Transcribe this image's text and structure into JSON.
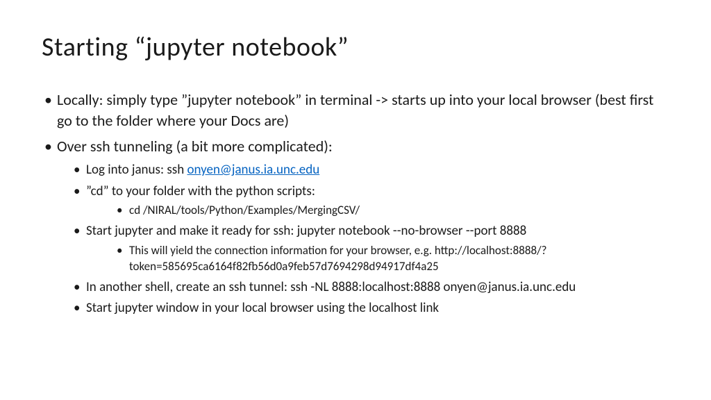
{
  "title": "Starting “jupyter notebook”",
  "bullets": {
    "b1": "Locally: simply type ”jupyter notebook” in terminal -> starts up into your local browser (best first go to the folder where your Docs are)",
    "b2": "Over ssh tunneling (a bit more complicated):",
    "b2_1_pre": "Log into janus: ssh ",
    "b2_1_link": "onyen@janus.ia.unc.edu",
    "b2_2": "”cd” to your folder with the python scripts:",
    "b2_2_1": "cd /NIRAL/tools/Python/Examples/MergingCSV/",
    "b2_3": "Start jupyter and make it ready for ssh: jupyter notebook --no-browser --port 8888",
    "b2_3_1": "This will yield the connection information for your browser, e.g. http://localhost:8888/?token=585695ca6164f82fb56d0a9feb57d7694298d94917df4a25",
    "b2_4": "In another shell, create an ssh tunnel: ssh -NL 8888:localhost:8888 onyen@janus.ia.unc.edu",
    "b2_5": "Start jupyter window in your local browser using the localhost link"
  }
}
